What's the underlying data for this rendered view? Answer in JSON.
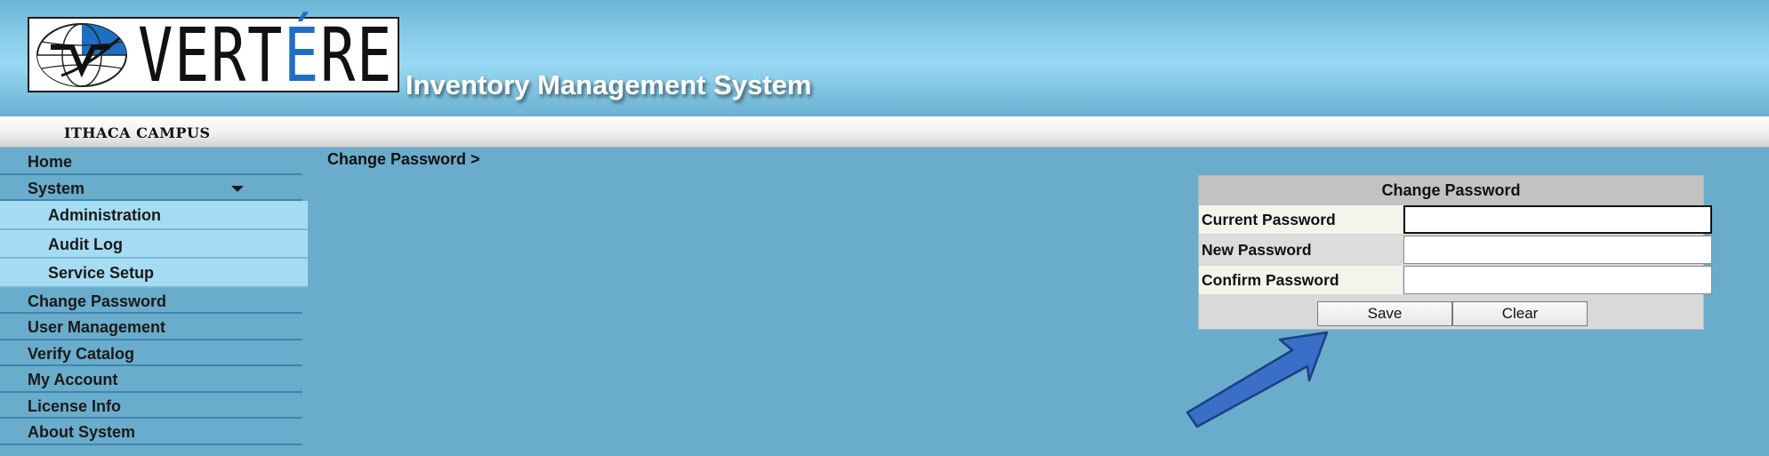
{
  "header": {
    "logo_text_prefix": "VERT",
    "logo_text_accent": "É",
    "logo_text_suffix": "RE",
    "app_title": "Inventory Management System"
  },
  "campus": {
    "label": "ITHACA CAMPUS"
  },
  "sidebar": {
    "items": [
      {
        "label": "Home"
      },
      {
        "label": "System",
        "icon": "caret-down-icon"
      },
      {
        "label": "Administration",
        "sub": true
      },
      {
        "label": "Audit Log",
        "sub": true
      },
      {
        "label": "Service Setup",
        "sub": true
      },
      {
        "label": "Change Password"
      },
      {
        "label": "User Management"
      },
      {
        "label": "Verify Catalog"
      },
      {
        "label": "My Account"
      },
      {
        "label": "License Info"
      },
      {
        "label": "About System"
      }
    ]
  },
  "breadcrumb": {
    "text": "Change Password >"
  },
  "change_password": {
    "title": "Change Password",
    "fields": [
      {
        "label": "Current Password",
        "value": ""
      },
      {
        "label": "New Password",
        "value": ""
      },
      {
        "label": "Confirm Password",
        "value": ""
      }
    ],
    "save_label": "Save",
    "clear_label": "Clear"
  },
  "colors": {
    "page_background": "#6aaccb",
    "submenu_background": "#a6dcf2",
    "logo_accent": "#1e6fc4",
    "annotation_arrow": "#3a6fc8"
  }
}
